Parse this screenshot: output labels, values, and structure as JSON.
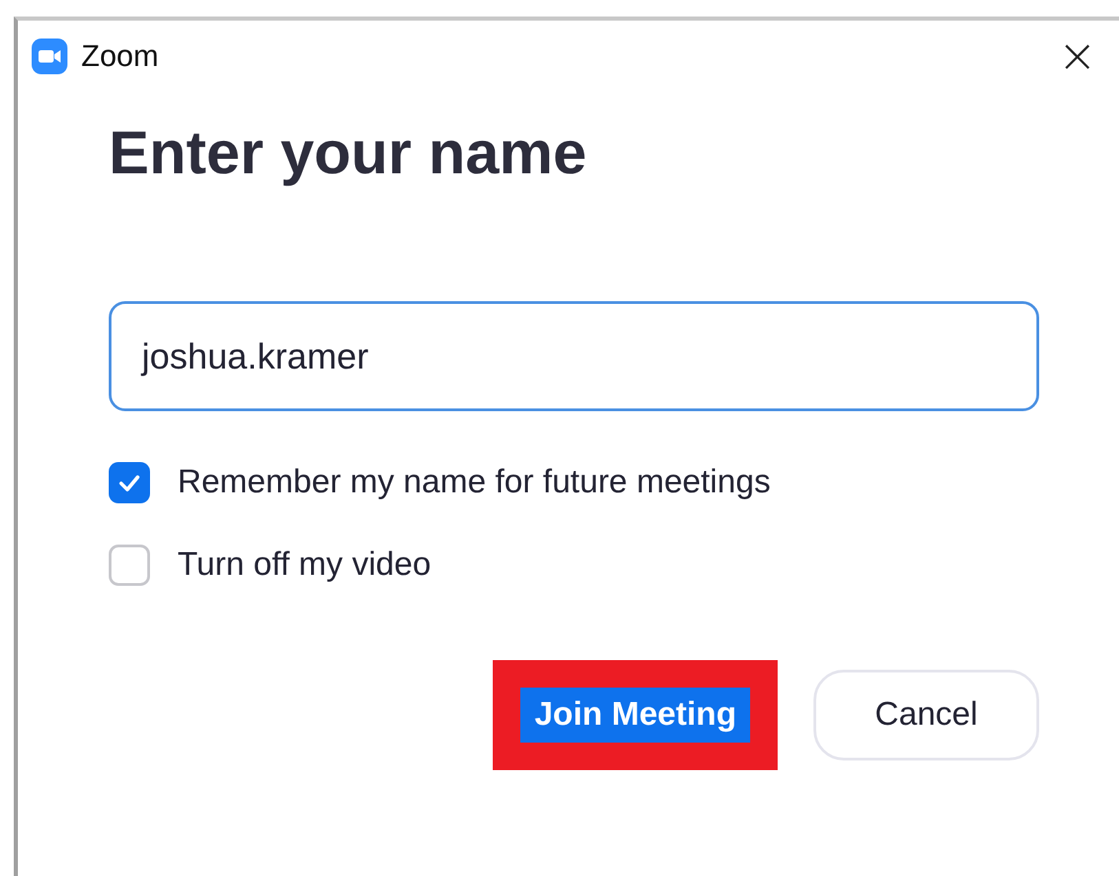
{
  "window": {
    "title": "Zoom",
    "close_symbol": "×"
  },
  "heading": "Enter your name",
  "name_field": {
    "value": "joshua.kramer"
  },
  "options": [
    {
      "label": "Remember my name for future meetings",
      "checked": true
    },
    {
      "label": "Turn off my video",
      "checked": false
    }
  ],
  "buttons": [
    {
      "label": "Join Meeting",
      "kind": "primary",
      "highlighted": true
    },
    {
      "label": "Cancel",
      "kind": "secondary",
      "highlighted": false
    }
  ]
}
